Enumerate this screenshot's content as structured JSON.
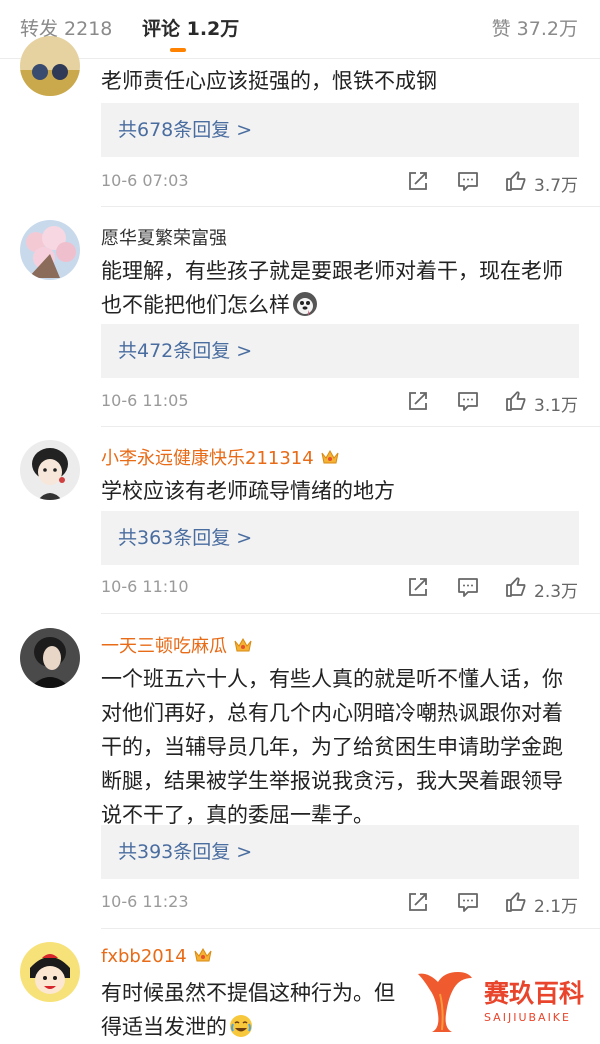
{
  "tabs": {
    "repost_label": "转发 2218",
    "comment_label": "评论 1.2万",
    "like_label": "赞 37.2万",
    "active": "comment",
    "accent_color": "#ff8200"
  },
  "comments": [
    {
      "username": "",
      "text": "老师责任心应该挺强的，恨铁不成钢",
      "replies_label": "共678条回复 >",
      "time": "10-6 07:03",
      "likes": "3.7万"
    },
    {
      "username": "愿华夏繁荣富强",
      "text": "能理解，有些孩子就是要跟老师对着干，现在老师也不能把他们怎么样",
      "emoji": "dog-face-emoji",
      "replies_label": "共472条回复 >",
      "time": "10-6 11:05",
      "likes": "3.1万"
    },
    {
      "username": "小李永远健康快乐211314",
      "vip": true,
      "text": "学校应该有老师疏导情绪的地方",
      "replies_label": "共363条回复 >",
      "time": "10-6 11:10",
      "likes": "2.3万"
    },
    {
      "username": "一天三顿吃麻瓜",
      "vip": true,
      "text": "一个班五六十人，有些人真的就是听不懂人话，你对他们再好，总有几个内心阴暗冷嘲热讽跟你对着干的，当辅导员几年，为了给贫困生申请助学金跑断腿，结果被学生举报说我贪污，我大哭着跟领导说不干了，真的委屈一辈子。",
      "replies_label": "共393条回复 >",
      "time": "10-6 11:23",
      "likes": "2.1万"
    },
    {
      "username": "fxbb2014",
      "vip": true,
      "text": "有时候虽然不提倡这种行为。但得适当发泄的",
      "emoji": "crying-laughing-emoji"
    }
  ],
  "colors": {
    "vip_name": "#e86b17",
    "reply_link": "#4a6da0",
    "meta_gray": "#9a9a9a"
  },
  "watermark": {
    "title": "赛玖百科",
    "subtitle": "SAIJIUBAIKE",
    "color": "#e8452c"
  }
}
